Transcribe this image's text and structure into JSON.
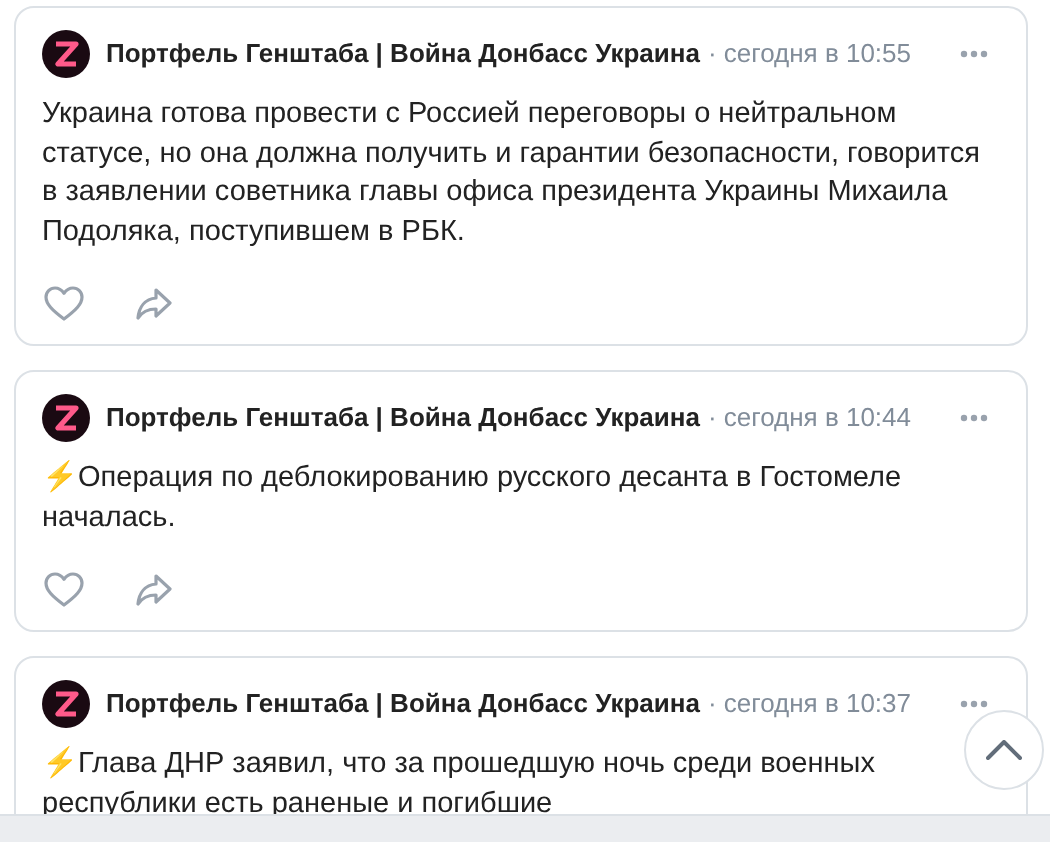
{
  "posts": [
    {
      "author": "Портфель Генштаба | Война Донбасс Украина",
      "time": "· сегодня в 10:55",
      "text": "Украина готова провести с Россией переговоры о нейтральном статусе, но она должна получить и гарантии безопасности, говорится в заявлении советника главы офиса президента Украины Михаила Подоляка, поступившем в РБК.",
      "liked": false
    },
    {
      "author": "Портфель Генштаба | Война Донбасс Украина",
      "time": "· сегодня в 10:44",
      "text": "⚡Операция по деблокированию русского десанта в Гостомеле началась.",
      "liked": false
    },
    {
      "author": "Портфель Генштаба | Война Донбасс Украина",
      "time": "· сегодня в 10:37",
      "text": "⚡Глава ДНР заявил, что за прошедшую ночь среди военных республики есть раненые и погибшие"
    }
  ]
}
